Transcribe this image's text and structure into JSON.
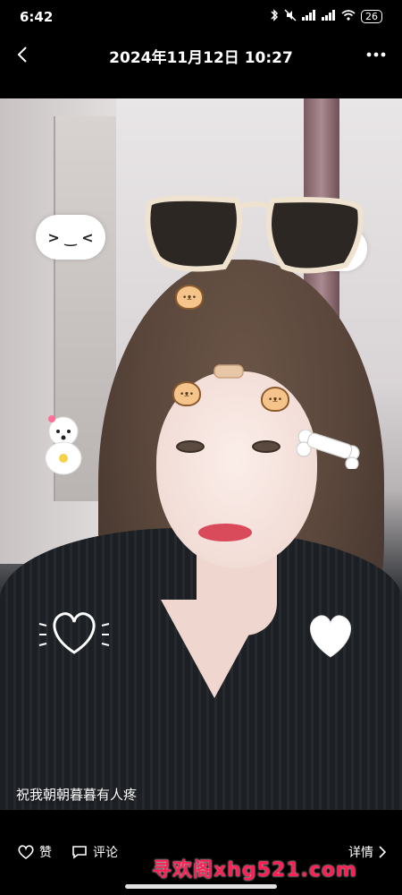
{
  "status_bar": {
    "time": "6:42",
    "battery": "26",
    "icons": [
      "bluetooth-icon",
      "mute-icon",
      "signal-icon",
      "signal-icon",
      "wifi-icon",
      "battery-icon"
    ]
  },
  "header": {
    "title": "2024年11月12日 10:27",
    "back_icon": "back-arrow-icon",
    "more_icon": "more-dots-icon"
  },
  "photo": {
    "caption": "祝我朝朝暮暮有人疼"
  },
  "bottom_bar": {
    "like_label": "赞",
    "comment_label": "评论",
    "detail_label": "详情"
  },
  "overlay": {
    "watermark": "寻欢阁xhg521.com"
  },
  "colors": {
    "background": "#000000",
    "watermark": "#ff1f55"
  }
}
